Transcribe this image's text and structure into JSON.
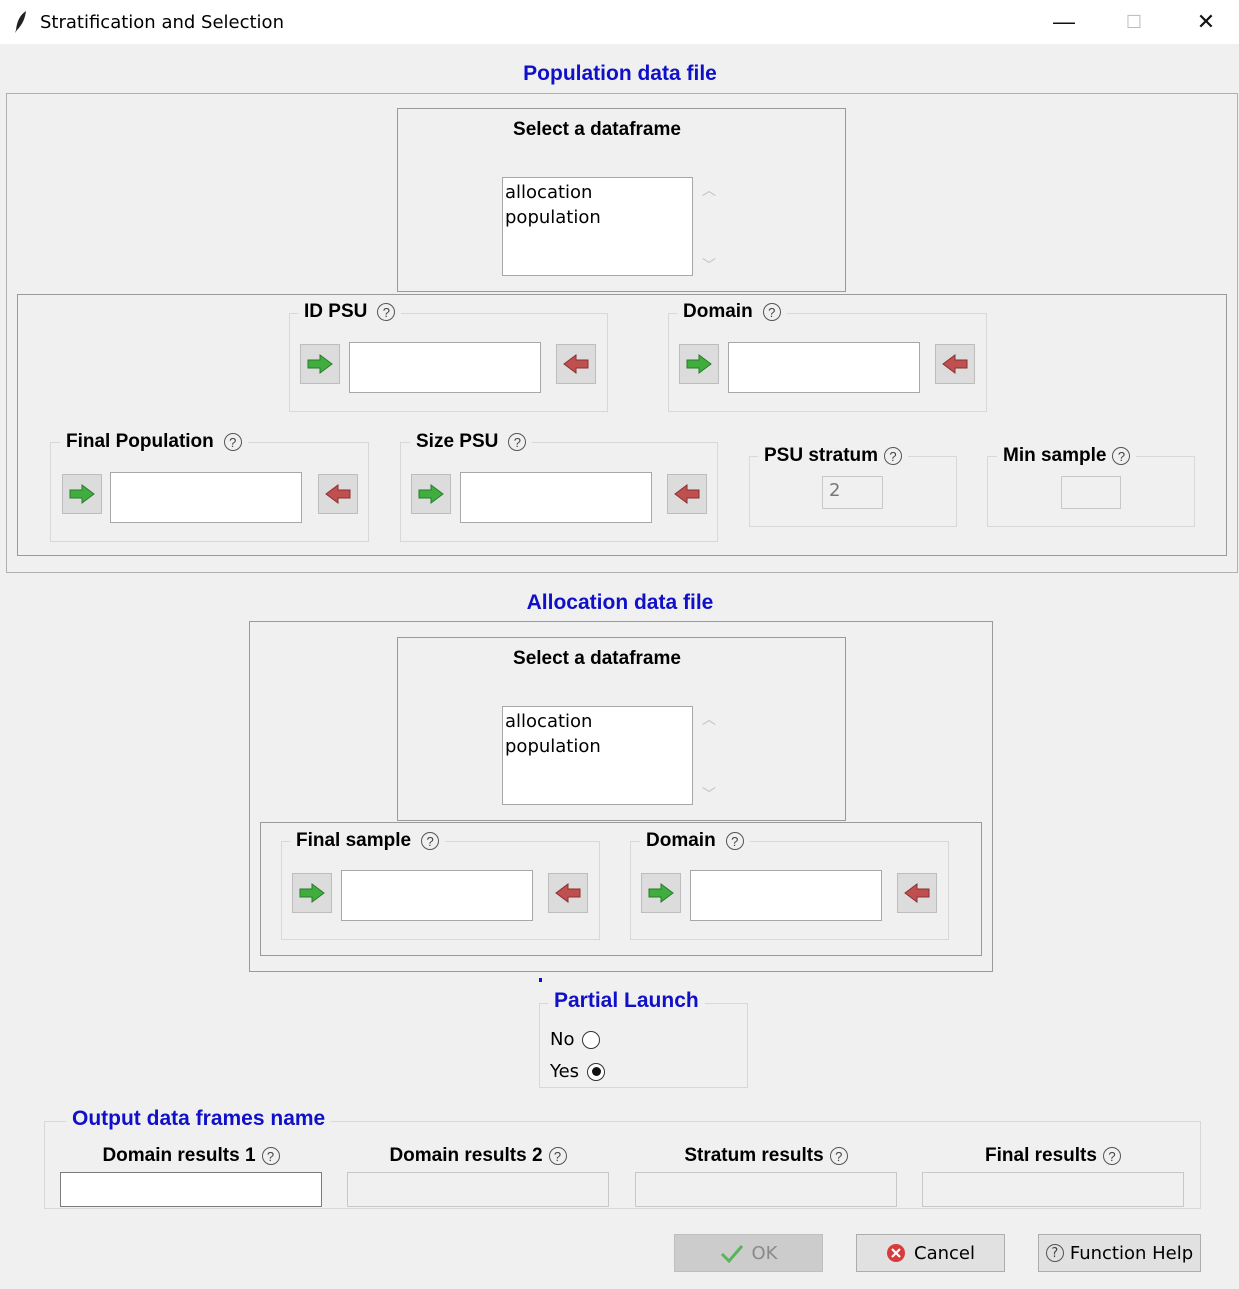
{
  "window": {
    "title": "Stratification and Selection",
    "minimize": "—",
    "maximize": "☐",
    "close": "✕"
  },
  "population": {
    "title": "Population data file",
    "select_label": "Select a dataframe",
    "dataframes": [
      "allocation",
      "population"
    ],
    "id_psu_label": "ID PSU",
    "domain_label": "Domain",
    "final_population_label": "Final Population",
    "size_psu_label": "Size PSU",
    "psu_stratum_label": "PSU stratum",
    "psu_stratum_value": "2",
    "min_sample_label": "Min sample"
  },
  "allocation": {
    "title": "Allocation data file",
    "select_label": "Select a dataframe",
    "dataframes": [
      "allocation",
      "population"
    ],
    "final_sample_label": "Final sample",
    "domain_label": "Domain"
  },
  "partial_launch": {
    "title": "Partial Launch",
    "options": [
      "No",
      "Yes"
    ],
    "selected": "Yes"
  },
  "output": {
    "title": "Output data frames name",
    "domain_results_1": "Domain results 1",
    "domain_results_2": "Domain results 2",
    "stratum_results": "Stratum results",
    "final_results": "Final results"
  },
  "buttons": {
    "ok": "OK",
    "cancel": "Cancel",
    "function_help": "Function Help"
  },
  "help_glyph": "?",
  "colors": {
    "section_title": "#1010c8",
    "green_arrow": "#3fae3f",
    "red_arrow": "#c05050"
  }
}
